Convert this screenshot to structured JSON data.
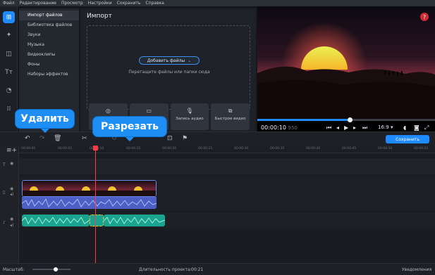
{
  "menu": [
    "Файл",
    "Редактирование",
    "Просмотр",
    "Настройки",
    "Сохранить",
    "Справка"
  ],
  "import_menu": [
    "Импорт файлов",
    "Библиотека файлов",
    "Звуки",
    "Музыка",
    "Видеоклипы",
    "Фоны",
    "Наборы эффектов"
  ],
  "import_panel": {
    "title": "Импорт",
    "add_files": "Добавить файлы",
    "hint": "Перетащите файлы или папки сюда",
    "tiles": [
      {
        "icon": "◎",
        "label": ""
      },
      {
        "icon": "▭",
        "label": ""
      },
      {
        "icon": "🎙",
        "label": "Запись аудио"
      },
      {
        "icon": "⧉",
        "label": "Быстрое видео"
      }
    ]
  },
  "player": {
    "timecode": "00:00:10",
    "timecode_ms": "950",
    "ratio": "16:9 ▾",
    "progress": 0.52,
    "help": "?"
  },
  "toolbar": {
    "save": "Сохранить",
    "tip_delete": "Удалить",
    "tip_cut": "Разрезать"
  },
  "ruler": [
    "00:00:00",
    "00:00:05",
    "00:00:10",
    "00:00:15",
    "00:00:20",
    "00:00:25",
    "00:00:30",
    "00:00:35",
    "00:00:40",
    "00:00:45",
    "00:00:50",
    "00:00:55"
  ],
  "status": {
    "scale": "Масштаб:",
    "duration_label": "Длительность проекта:",
    "duration": "00:21",
    "notifications": "Уведомления"
  },
  "colors": {
    "accent": "#1f8bff",
    "playhead": "#ff3b47",
    "music": "#1aa38e",
    "audio": "#4b5fc4"
  }
}
